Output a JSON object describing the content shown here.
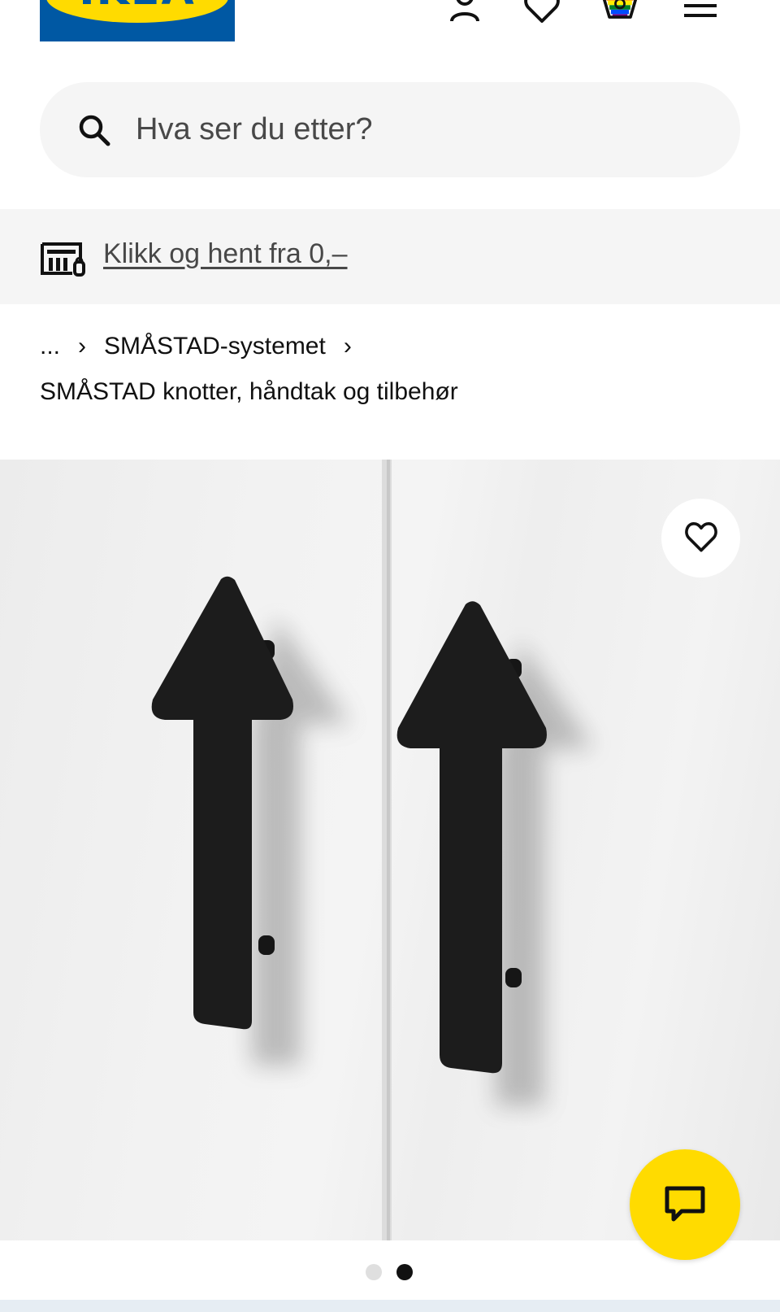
{
  "header": {
    "logo_text": "IKEA",
    "icons": [
      "account-icon",
      "heart-icon",
      "shopping-bag-icon",
      "hamburger-menu-icon"
    ]
  },
  "search": {
    "placeholder": "Hva ser du etter?"
  },
  "promo": {
    "link_text": "Klikk og hent fra 0,–",
    "icon": "click-and-collect-icon"
  },
  "breadcrumb": {
    "ellipsis": "...",
    "separator": "›",
    "parent": "SMÅSTAD-systemet",
    "current": "SMÅSTAD knotter, håndtak og tilbehør"
  },
  "product_image": {
    "favourite_icon": "heart-icon",
    "chat_icon": "chat-bubble-icon"
  },
  "carousel": {
    "total": 2,
    "active_index": 1
  },
  "colors": {
    "brand_blue": "#0058a3",
    "brand_yellow": "#ffdb00",
    "panel_grey": "#f5f5f5"
  }
}
